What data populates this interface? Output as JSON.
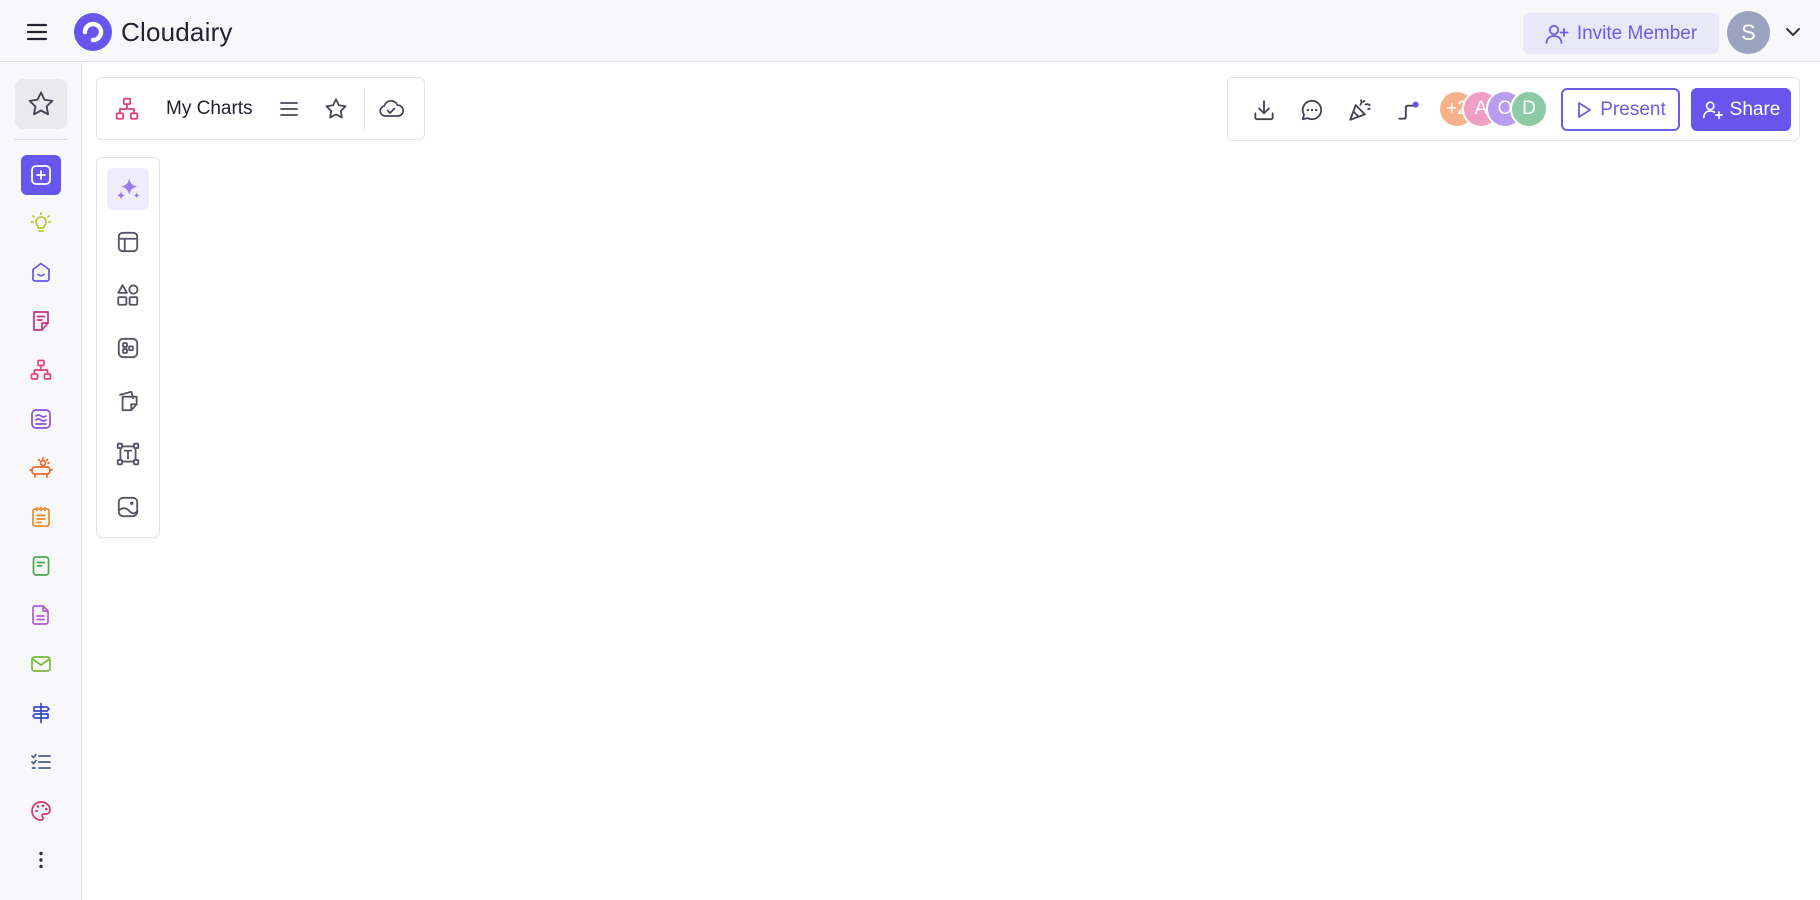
{
  "header": {
    "brand_name": "Cloudairy",
    "invite_label": "Invite Member",
    "user_initial": "S"
  },
  "document": {
    "title": "My Charts"
  },
  "collaborators": [
    {
      "label": "+2",
      "color": "#f7b388"
    },
    {
      "label": "A",
      "color": "#ef9fc4"
    },
    {
      "label": "O",
      "color": "#b89cf0"
    },
    {
      "label": "D",
      "color": "#8ccba4"
    }
  ],
  "toolbar": {
    "present_label": "Present",
    "share_label": "Share"
  },
  "sidebar": {
    "items": [
      {
        "icon": "add-square-icon",
        "color": "#ffffff",
        "active": true
      },
      {
        "icon": "lightbulb-icon",
        "color": "#b5c930"
      },
      {
        "icon": "home-icon",
        "color": "#6656ee"
      },
      {
        "icon": "sticky-note-icon",
        "color": "#c4308a"
      },
      {
        "icon": "flowchart-icon",
        "color": "#e0447a"
      },
      {
        "icon": "wave-list-icon",
        "color": "#8a4fe0"
      },
      {
        "icon": "idea-board-icon",
        "color": "#ee6a22"
      },
      {
        "icon": "notepad-icon",
        "color": "#f08a2a"
      },
      {
        "icon": "document-icon",
        "color": "#49a84a"
      },
      {
        "icon": "file-text-icon",
        "color": "#b55bd6"
      },
      {
        "icon": "mail-icon",
        "color": "#79b83a"
      },
      {
        "icon": "signpost-icon",
        "color": "#3848c8"
      },
      {
        "icon": "checklist-icon",
        "color": "#4a5a8a"
      },
      {
        "icon": "palette-icon",
        "color": "#d8336a"
      },
      {
        "icon": "more-vertical-icon",
        "color": "#333344"
      }
    ]
  },
  "tools": [
    {
      "icon": "ai-sparkle-icon",
      "active": true
    },
    {
      "icon": "template-icon"
    },
    {
      "icon": "shapes-icon"
    },
    {
      "icon": "components-icon"
    },
    {
      "icon": "sticky-notes-icon"
    },
    {
      "icon": "text-box-icon"
    },
    {
      "icon": "image-icon"
    }
  ],
  "colors": {
    "accent": "#6656ee",
    "invite_bg": "#e9e8f8",
    "user_avatar": "#9aa3bf"
  }
}
